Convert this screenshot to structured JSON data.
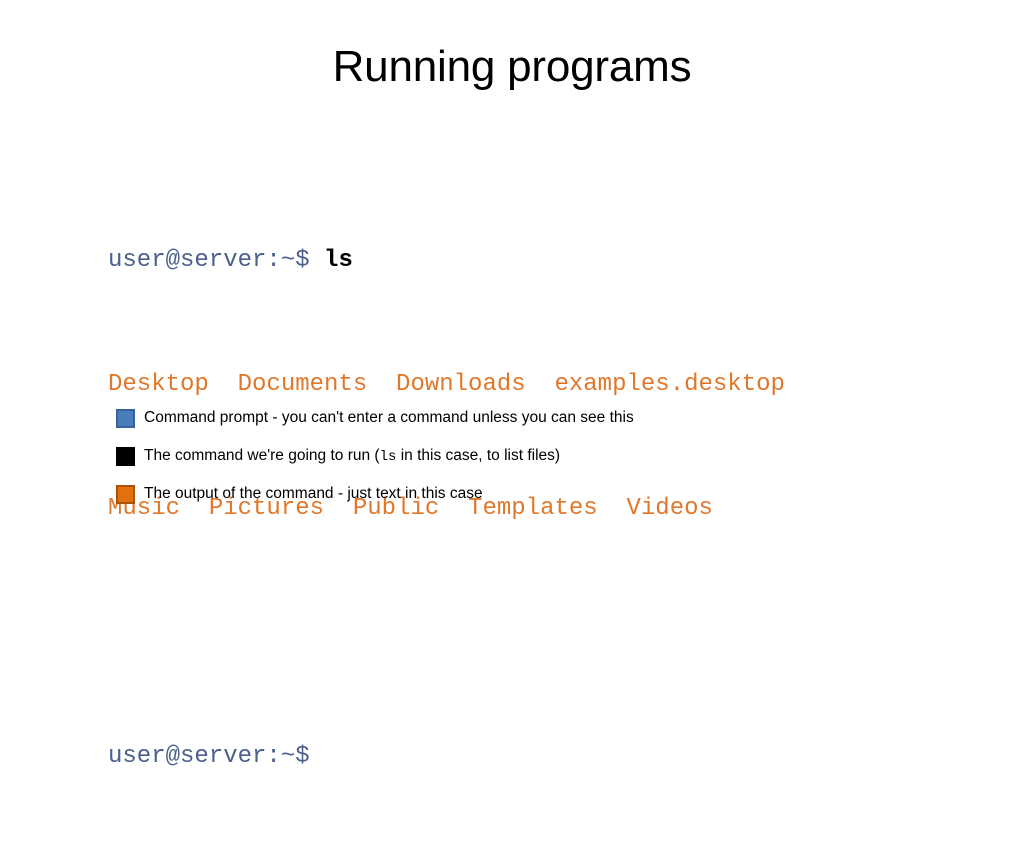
{
  "slide": {
    "title": "Running programs",
    "background_color": "#ffffff"
  },
  "terminal": {
    "prompt_color": "#4C5F8C",
    "command_color": "#000000",
    "output_color": "#E0782B",
    "lines": [
      {
        "type": "prompt-command",
        "prompt": "user@server:~$ ",
        "command": "ls"
      },
      {
        "type": "output",
        "text": "Desktop  Documents  Downloads  examples.desktop"
      },
      {
        "type": "output",
        "text": "Music  Pictures  Public  Templates  Videos"
      },
      {
        "type": "blank",
        "text": ""
      },
      {
        "type": "prompt",
        "prompt": "user@server:~$"
      }
    ]
  },
  "legend": {
    "rows": [
      {
        "swatch_color": "#4A7EBB",
        "swatch_border": "#3A6198",
        "swatch_name": "blue-swatch",
        "text_before": "Command prompt - you can't enter a command unless you can see this",
        "mono": "",
        "text_after": ""
      },
      {
        "swatch_color": "#000000",
        "swatch_border": "#000000",
        "swatch_name": "black-swatch",
        "text_before": "The command we're going to run (",
        "mono": "ls",
        "text_after": " in this case, to list files)"
      },
      {
        "swatch_color": "#E2700C",
        "swatch_border": "#A75408",
        "swatch_name": "orange-swatch",
        "text_before": "The output of the command - just text in this case",
        "mono": "",
        "text_after": ""
      }
    ]
  }
}
